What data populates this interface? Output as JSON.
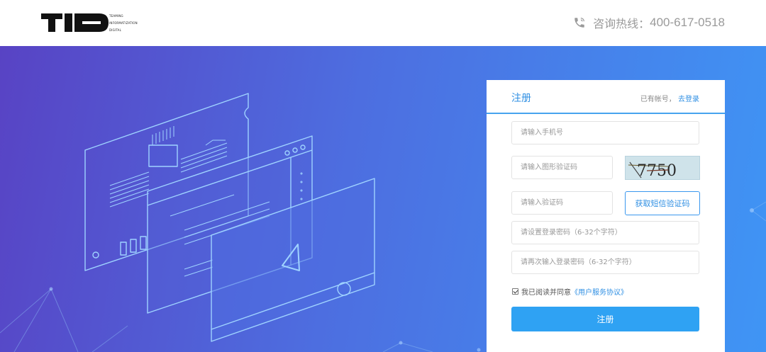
{
  "header": {
    "logo_sub_lines": [
      "TEAMING",
      "INFORMATIZATION",
      "DIGITAL"
    ],
    "hotline_label": "咨询热线：",
    "hotline_number": "400-617-0518"
  },
  "register": {
    "title": "注册",
    "has_account": "已有帐号，",
    "login_link": "去登录",
    "phone_placeholder": "请输入手机号",
    "captcha_placeholder": "请输入图形验证码",
    "captcha_text": "7750",
    "sms_placeholder": "请输入验证码",
    "sms_button": "获取短信验证码",
    "password_placeholder": "请设置登录密码（6-32个字符）",
    "password_confirm_placeholder": "请再次输入登录密码（6-32个字符）",
    "agree_prefix": "我已阅读并同意",
    "agree_link": "《用户服务协议》",
    "agree_checked": true,
    "submit_label": "注册"
  },
  "icons": {
    "hotline": "phone-icon",
    "checkbox": "checkmark-icon"
  },
  "colors": {
    "accent": "#2f8fe3",
    "button": "#2fa2f3",
    "hero_start": "#5843c4",
    "hero_end": "#3f95f5"
  }
}
